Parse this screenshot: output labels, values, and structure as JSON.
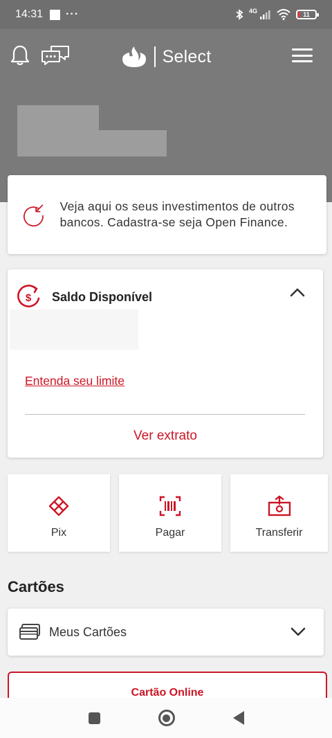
{
  "status_bar": {
    "time": "14:31",
    "network": "4G",
    "battery": "11"
  },
  "header": {
    "brand_name": "Select"
  },
  "open_finance": {
    "message": "Veja aqui os seus investimentos de outros bancos. Cadastra-se seja Open Finance."
  },
  "saldo": {
    "title": "Saldo Disponível",
    "limit_link": "Entenda seu limite",
    "statement_button": "Ver extrato"
  },
  "quick_actions": [
    {
      "label": "Pix",
      "icon": "pix-icon"
    },
    {
      "label": "Pagar",
      "icon": "barcode-icon"
    },
    {
      "label": "Transferir",
      "icon": "transfer-icon"
    }
  ],
  "cards_section": {
    "title": "Cartões",
    "my_cards_label": "Meus Cartões",
    "online_card_button": "Cartão Online"
  },
  "colors": {
    "brand_red": "#cc1525",
    "header_gray": "#7a7a7a"
  }
}
